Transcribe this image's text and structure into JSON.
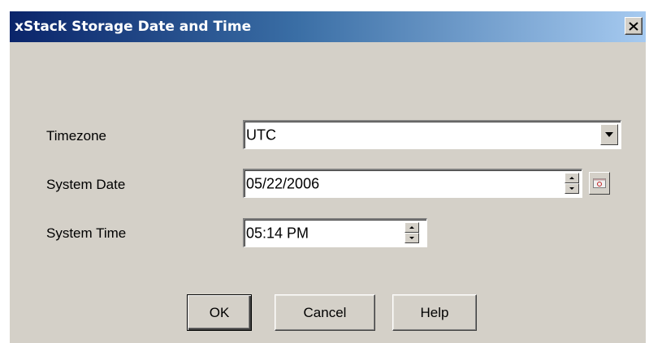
{
  "window": {
    "title": "xStack Storage Date and Time",
    "close_icon": "close-icon"
  },
  "timezone": {
    "label": "Timezone",
    "value": "UTC"
  },
  "system_date": {
    "label": "System Date",
    "value": "05/22/2006"
  },
  "system_time": {
    "label": "System Time",
    "value": "05:14 PM"
  },
  "buttons": {
    "ok": "OK",
    "cancel": "Cancel",
    "help": "Help"
  },
  "colors": {
    "title_bar_start": "#0a246a",
    "title_bar_end": "#a6caf0",
    "dialog_bg": "#d4d0c8"
  }
}
